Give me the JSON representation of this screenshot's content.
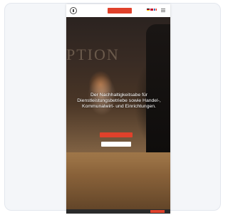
{
  "header": {
    "cta_label": "",
    "languages": [
      "DE",
      "EN",
      "FR"
    ]
  },
  "hero": {
    "sign_text": "PTION",
    "headline": "Der Nachhaltigkeitsabe für Dienstleistungsbetriebe sowie Handel-, Kommunalwirt- und Einrichtungen.",
    "primary_button_label": "",
    "secondary_button_label": ""
  },
  "cookie_bar": {
    "text": "",
    "button_label": ""
  },
  "colors": {
    "accent": "#e0412b",
    "page_background": "#f4f6f9"
  },
  "icons": {
    "logo": "circle-logo-icon",
    "menu": "hamburger-menu-icon"
  }
}
